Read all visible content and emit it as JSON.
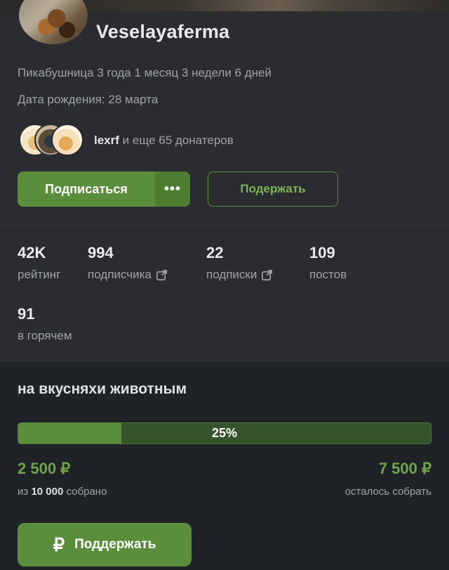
{
  "profile": {
    "username": "Veselayaferma",
    "member_since": "Пикабушница 3 года 1 месяц 3 недели 6 дней",
    "birthday": "Дата рождения: 28 марта",
    "donors": {
      "lead_name": "lexrf",
      "rest": " и еще 65 донатеров"
    },
    "subscribe_label": "Подписаться",
    "more_label": "•••",
    "support_label": "Подержать"
  },
  "stats": [
    {
      "value": "42K",
      "label": "рейтинг"
    },
    {
      "value": "994",
      "label": "подписчика"
    },
    {
      "value": "22",
      "label": "подписки"
    },
    {
      "value": "109",
      "label": "постов"
    },
    {
      "value": "91",
      "label": "в горячем"
    }
  ],
  "fundraiser": {
    "title": "на вкусняхи животным",
    "progress_percent": 25,
    "progress_label": "25%",
    "collected": "2 500 ₽",
    "remaining": "7 500 ₽",
    "collected_prefix": "из ",
    "goal": "10 000",
    "collected_suffix": " собрано",
    "remaining_label": "осталось собрать",
    "button_label": "Поддержать",
    "button_icon": "₽"
  },
  "colors": {
    "accent": "#5a8e3c",
    "accent_text": "#6fa547",
    "background": "#1d2024",
    "panel": "#2a2c30"
  }
}
